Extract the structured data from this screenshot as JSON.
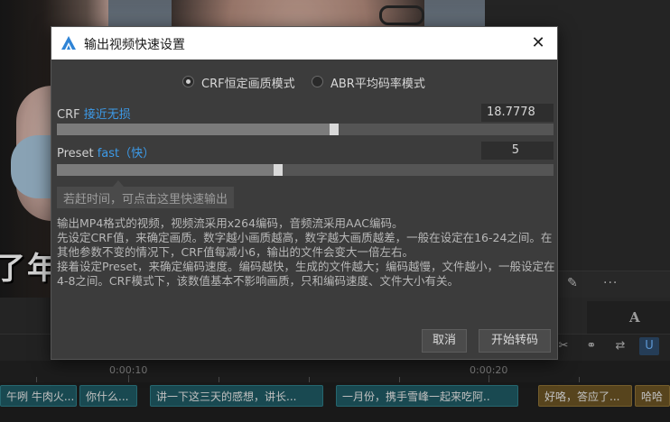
{
  "background": {
    "video_subtitle_text": "了年",
    "timeline": {
      "ruler_labels": [
        "0:00:10",
        "0:00:20"
      ],
      "clips": [
        {
          "label": "午咧 牛肉火...",
          "color": "teal"
        },
        {
          "label": "你什么...",
          "color": "teal"
        },
        {
          "label": "讲一下这三天的感想，讲长...",
          "color": "teal"
        },
        {
          "label": "一月份，携手雪峰一起来吃阿..",
          "color": "teal"
        },
        {
          "label": "好咯，答应了...",
          "color": "gold"
        },
        {
          "label": "哈哈",
          "color": "gold"
        }
      ]
    },
    "right_panel": {
      "text_tool_label": "A"
    }
  },
  "dialog": {
    "title": "输出视频快速设置",
    "close_glyph": "✕",
    "modes": [
      {
        "label": "CRF恒定画质模式",
        "checked": true
      },
      {
        "label": "ABR平均码率模式",
        "checked": false
      }
    ],
    "crf": {
      "label": "CRF",
      "quality_text": "接近无损",
      "value": "18.7778",
      "slider_fraction": 0.56
    },
    "preset": {
      "label": "Preset",
      "preset_text": "fast（快）",
      "value": "5",
      "slider_fraction": 0.445
    },
    "hint": "若赶时间，可点击这里快速输出",
    "description": [
      "输出MP4格式的视频，视频流采用x264编码，音频流采用AAC编码。",
      "先设定CRF值，来确定画质。数字越小画质越高，数字越大画质越差，一般在设定在16-24之间。在其他参数不变的情况下，CRF值每减小6，输出的文件会变大一倍左右。",
      "接着设定Preset，来确定编码速度。编码越快，生成的文件越大；编码越慢，文件越小，一般设定在4-8之间。CRF模式下，该数值基本不影响画质，只和编码速度、文件大小有关。"
    ],
    "buttons": {
      "cancel": "取消",
      "start": "开始转码"
    },
    "colors": {
      "accent": "#3d9be9",
      "logo": "#2f84d6"
    }
  }
}
